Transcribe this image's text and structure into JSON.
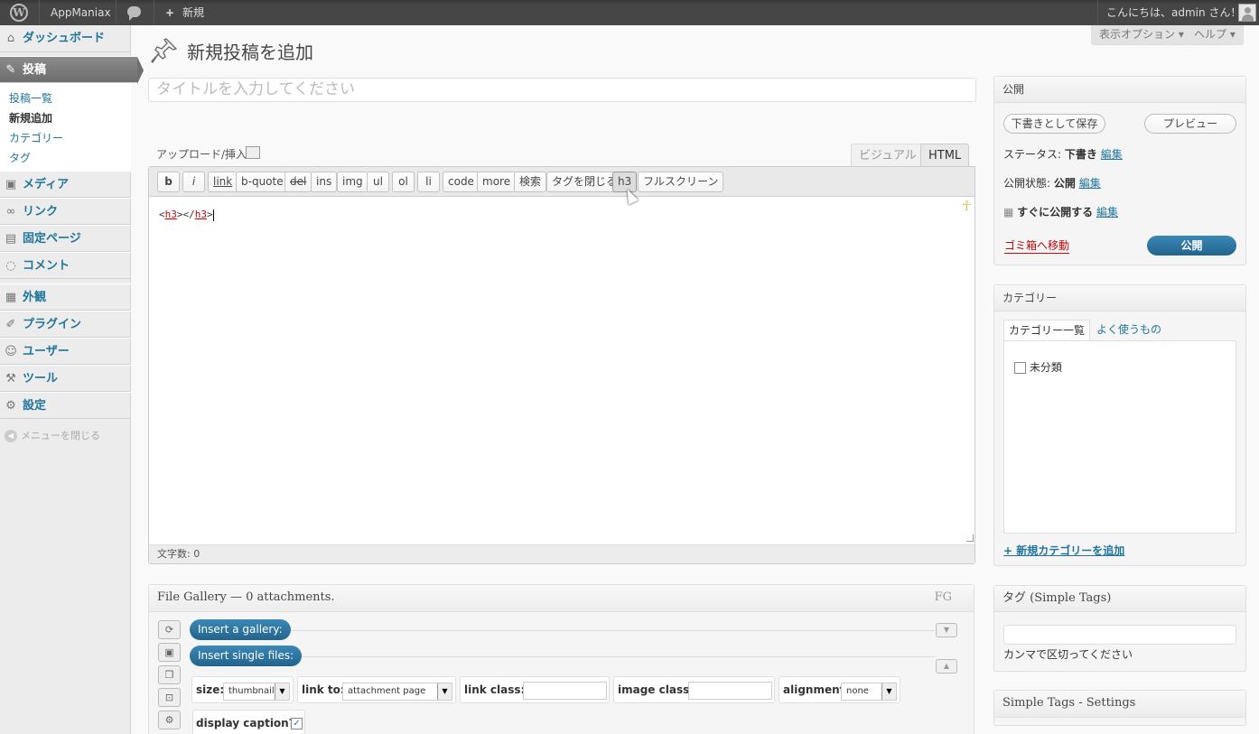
{
  "adminbar": {
    "site_name": "AppManiax",
    "new_label": "新規",
    "greeting": "こんにちは、admin さん！"
  },
  "screen_tabs": {
    "options": "表示オプション ▾",
    "help": "ヘルプ ▾"
  },
  "sidebar": {
    "dashboard": "ダッシュボード",
    "posts": "投稿",
    "submenu": [
      "投稿一覧",
      "新規追加",
      "カテゴリー",
      "タグ"
    ],
    "media": "メディア",
    "links": "リンク",
    "pages": "固定ページ",
    "comments": "コメント",
    "appearance": "外観",
    "plugins": "プラグイン",
    "users": "ユーザー",
    "tools": "ツール",
    "settings": "設定",
    "collapse": "メニューを閉じる"
  },
  "page_title": "新規投稿を追加",
  "title_placeholder": "タイトルを入力してください",
  "editor": {
    "upload_label": "アップロード/挿入",
    "tab_visual": "ビジュアル",
    "tab_html": "HTML",
    "quicktags": [
      "b",
      "i",
      "link",
      "b-quote",
      "del",
      "ins",
      "img",
      "ul",
      "ol",
      "li",
      "code",
      "more",
      "検索",
      "タグを閉じる",
      "h3",
      "フルスクリーン"
    ],
    "content_open": "<",
    "content_tag1": "h3",
    "content_mid": "></",
    "content_tag2": "h3",
    "content_close": ">",
    "word_count": "文字数: 0"
  },
  "file_gallery": {
    "title": "File Gallery — 0 attachments.",
    "badge": "FG",
    "insert_gallery": "Insert a gallery:",
    "insert_single": "Insert single files:",
    "size_label": "size:",
    "size_value": "thumbnail",
    "link_to_label": "link to:",
    "link_to_value": "attachment page",
    "link_class_label": "link class:",
    "image_class_label": "image class:",
    "alignment_label": "alignment:",
    "alignment_value": "none",
    "display_caption_label": "display caption?"
  },
  "publish_box": {
    "title": "公開",
    "save_draft": "下書きとして保存",
    "preview": "プレビュー",
    "status_label": "ステータス:",
    "status_value": "下書き",
    "visibility_label": "公開状態:",
    "visibility_value": "公開",
    "schedule_label": "すぐに公開する",
    "edit": "編集",
    "trash": "ゴミ箱へ移動",
    "publish": "公開"
  },
  "category_box": {
    "title": "カテゴリー",
    "tab_all": "カテゴリー一覧",
    "tab_popular": "よく使うもの",
    "items": [
      "未分類"
    ],
    "add_new": "+ 新規カテゴリーを追加"
  },
  "tags_box": {
    "title": "タグ (Simple Tags)",
    "hint": "カンマで区切ってください"
  },
  "simple_tags_settings": {
    "title": "Simple Tags - Settings"
  }
}
